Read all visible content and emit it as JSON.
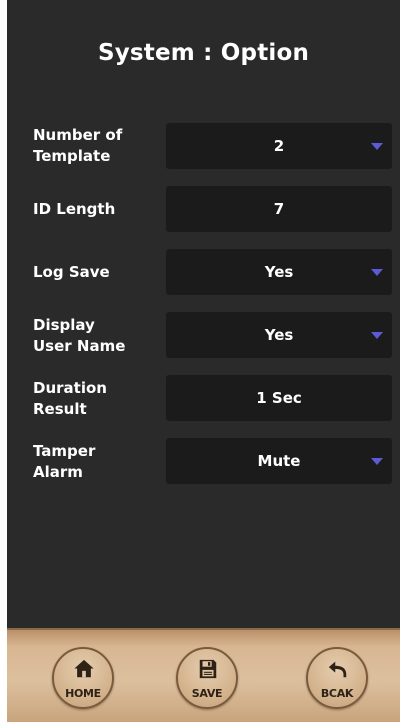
{
  "header": {
    "title": "System : Option"
  },
  "rows": [
    {
      "label": "Number of\nTemplate",
      "value": "2",
      "dropdown": true
    },
    {
      "label": "ID Length",
      "value": "7",
      "dropdown": false
    },
    {
      "label": "Log Save",
      "value": "Yes",
      "dropdown": true
    },
    {
      "label": "Display\nUser Name",
      "value": "Yes",
      "dropdown": true
    },
    {
      "label": "Duration\nResult",
      "value": "1 Sec",
      "dropdown": false
    },
    {
      "label": "Tamper\nAlarm",
      "value": "Mute",
      "dropdown": true
    }
  ],
  "nav": {
    "home": {
      "label": "HOME",
      "icon": "house-icon"
    },
    "save": {
      "label": "SAVE",
      "icon": "floppy-disk-icon"
    },
    "back": {
      "label": "BCAK",
      "icon": "back-arrow-icon"
    }
  },
  "colors": {
    "screen_bg": "#2a2a2a",
    "field_bg": "#1b1b1b",
    "caret": "#5b5bd6",
    "bar": "#d8b692"
  }
}
